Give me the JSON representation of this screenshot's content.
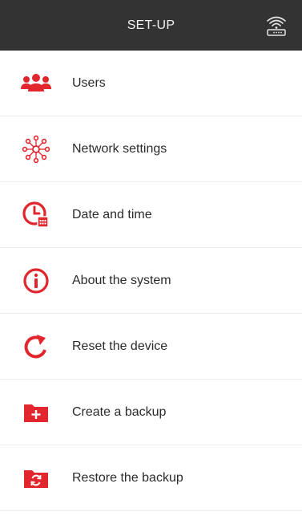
{
  "header": {
    "title": "SET-UP",
    "status_icon": "wifi-router-icon"
  },
  "menu": {
    "items": [
      {
        "label": "Users",
        "icon": "users-icon"
      },
      {
        "label": "Network settings",
        "icon": "network-icon"
      },
      {
        "label": "Date and time",
        "icon": "clock-calendar-icon"
      },
      {
        "label": "About the system",
        "icon": "info-icon"
      },
      {
        "label": "Reset the device",
        "icon": "reset-icon"
      },
      {
        "label": "Create a backup",
        "icon": "folder-plus-icon"
      },
      {
        "label": "Restore the backup",
        "icon": "folder-restore-icon"
      }
    ]
  },
  "colors": {
    "header_bg": "#333333",
    "accent": "#e1262d",
    "text": "#2b2b2b",
    "divider": "#eeeeee"
  }
}
